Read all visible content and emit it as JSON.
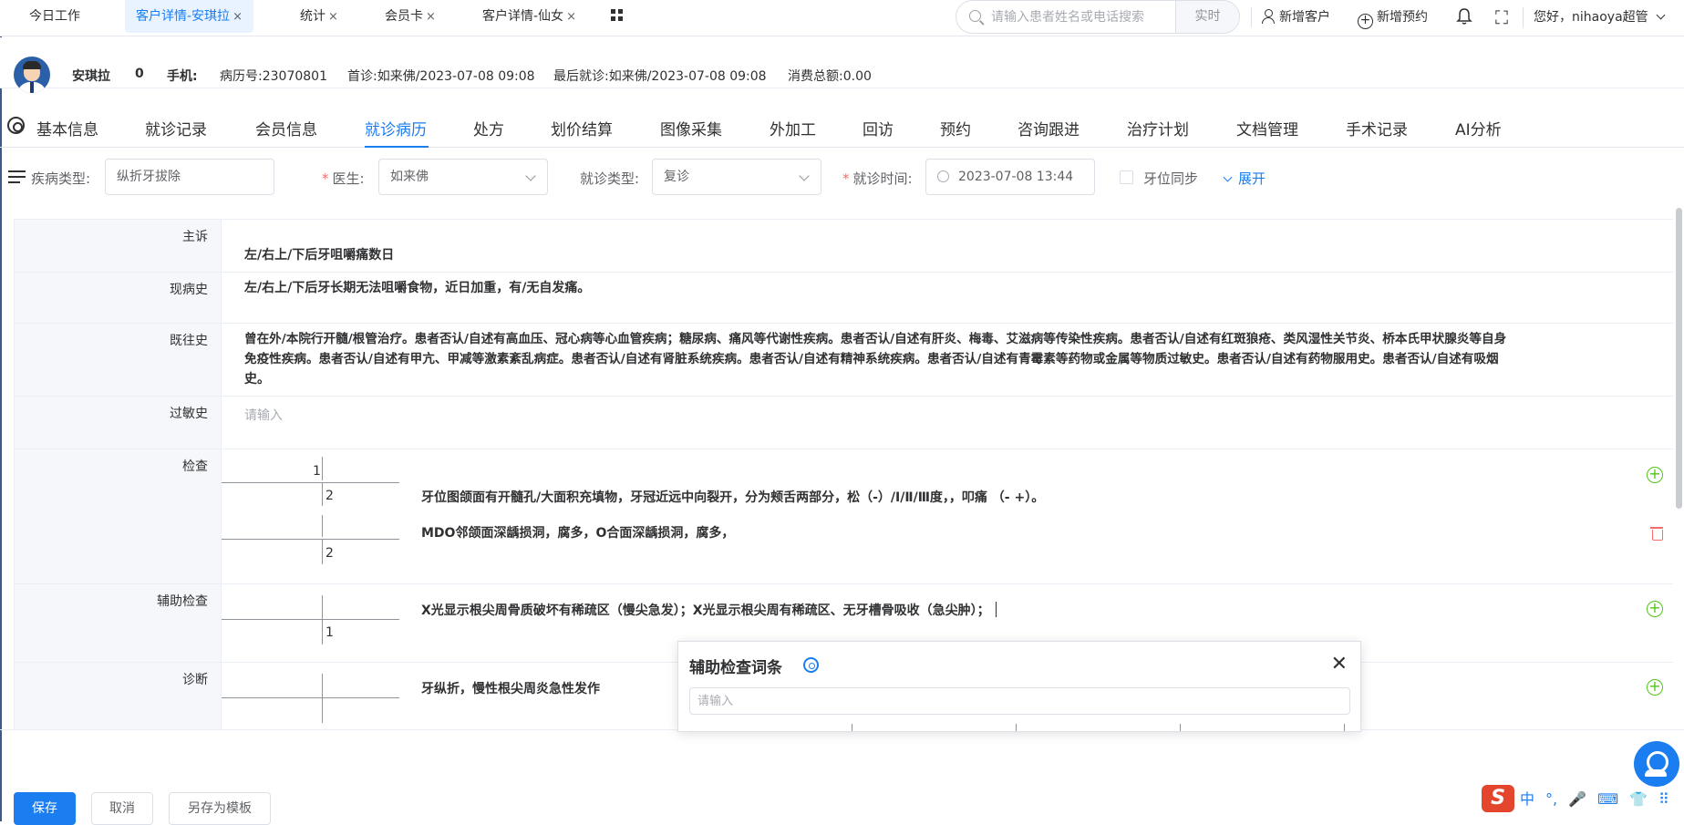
{
  "top_tabs": [
    {
      "label": "今日工作",
      "closable": false,
      "active": false
    },
    {
      "label": "客户详情-安琪拉",
      "closable": true,
      "active": true
    },
    {
      "label": "统计",
      "closable": true,
      "active": false
    },
    {
      "label": "会员卡",
      "closable": true,
      "active": false
    },
    {
      "label": "客户详情-仙女",
      "closable": true,
      "active": false
    }
  ],
  "close_glyph": "×",
  "search": {
    "placeholder": "请输入患者姓名或电话搜索",
    "mode": "实时"
  },
  "actions": {
    "new_customer": "新增客户",
    "new_appointment": "新增预约",
    "greeting": "您好，nihaoya超管"
  },
  "patient": {
    "name": "安琪拉",
    "age": "0",
    "phone_label": "手机:",
    "phone": "",
    "record_no": "病历号:23070801",
    "first_visit": "首诊:如来佛/2023-07-08 09:08",
    "last_visit": "最后就诊:如来佛/2023-07-08 09:08",
    "total_spent": "消费总额:0.00"
  },
  "module_tabs": [
    "基本信息",
    "就诊记录",
    "会员信息",
    "就诊病历",
    "处方",
    "划价结算",
    "图像采集",
    "外加工",
    "回访",
    "预约",
    "咨询跟进",
    "治疗计划",
    "文档管理",
    "手术记录",
    "AI分析"
  ],
  "active_module": "就诊病历",
  "filters": {
    "disease_type_label": "疾病类型:",
    "disease_type_value": "纵折牙拔除",
    "doctor_label": "医生:",
    "doctor_value": "如来佛",
    "visit_type_label": "就诊类型:",
    "visit_type_value": "复诊",
    "visit_time_label": "就诊时间:",
    "visit_time_value": "2023-07-08 13:44",
    "tooth_sync_label": "牙位同步",
    "expand_label": "展开"
  },
  "record": {
    "chief_complaint_label": "主诉",
    "chief_complaint": "左/右上/下后牙咀嚼痛数日",
    "present_illness_label": "现病史",
    "present_illness": "左/右上/下后牙长期无法咀嚼食物，近日加重，有/无自发痛。",
    "past_history_label": "既往史",
    "past_history_lines": [
      "曾在外/本院行开髓/根管治疗。患者否认/自述有高血压、冠心病等心血管疾病；糖尿病、痛风等代谢性疾病。患者否认/自述有肝炎、梅毒、艾滋病等传染性疾病。患者否认/自述有红斑狼疮、类风湿性关节炎、桥本氏甲状腺炎等自身",
      "免疫性疾病。患者否认/自述有甲亢、甲减等激素紊乱病症。患者否认/自述有肾脏系统疾病。患者否认/自述有精神系统疾病。患者否认/自述有青霉素等药物或金属等物质过敏史。患者否认/自述有药物服用史。患者否认/自述有吸烟",
      "史。"
    ],
    "allergy_label": "过敏史",
    "allergy_placeholder": "请输入",
    "exam_label": "检查",
    "exam_teeth": {
      "t1": "1",
      "t2": "2",
      "t3": "2"
    },
    "exam_line1": "牙位图颌面有开髓孔/大面积充填物，牙冠近远中向裂开，分为颊舌两部分，松（-）/Ⅰ/Ⅱ/Ⅲ度，，叩痛 （- +）。",
    "exam_line2": "MDO邻颌面深龋损洞，腐多，O合面深龋损洞，腐多，",
    "aux_label": "辅助检查",
    "aux_tooth": "1",
    "aux_text": "X光显示根尖周骨质破坏有稀疏区（慢尖急发）；X光显示根尖周有稀疏区、无牙槽骨吸收（急尖肿）；",
    "diag_label": "诊断",
    "diag_text": "牙纵折，慢性根尖周炎急性发作"
  },
  "popup": {
    "title": "辅助检查词条",
    "close": "✕",
    "placeholder": "请输入"
  },
  "buttons": {
    "save": "保存",
    "cancel": "取消",
    "save_as_template": "另存为模板"
  },
  "ime": {
    "logo": "S",
    "items": [
      "中",
      "°,",
      "🎤",
      "⌨",
      "👕",
      "⠿"
    ]
  },
  "colors": {
    "accent": "#1a7ef0",
    "add_green": "#52c41a",
    "danger": "#f56c6c",
    "ime_red": "#e3462d"
  }
}
